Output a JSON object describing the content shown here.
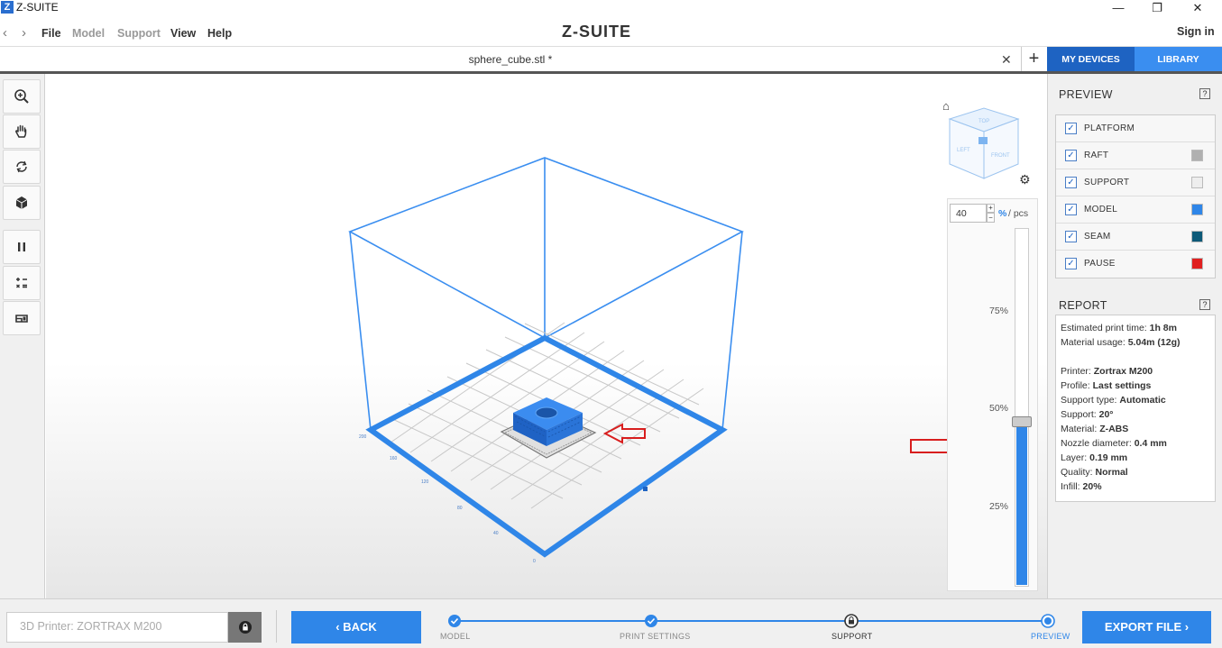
{
  "window": {
    "logo_letter": "Z",
    "title": "Z-SUITE",
    "minimize": "—",
    "maximize": "❐",
    "close": "✕"
  },
  "menubar": {
    "items": [
      "File",
      "Model",
      "Support",
      "View",
      "Help"
    ],
    "brand": "Z-SUITE",
    "signin": "Sign in"
  },
  "tabbar": {
    "file_tab": "sphere_cube.stl *",
    "close": "✕",
    "add": "+",
    "my_devices": "MY DEVICES",
    "library": "LIBRARY"
  },
  "toolbar": {
    "tools": [
      "zoom-icon",
      "pan-hand-icon",
      "rotate-icon",
      "view-cube-icon",
      "pause-icon",
      "calculator-icon",
      "layers-icon"
    ]
  },
  "viewport": {
    "cube_faces": [
      "TOP",
      "LEFT",
      "FRONT"
    ],
    "layer_value": "40",
    "unit_percent": "%",
    "unit_pcs": "/ pcs",
    "slider_ticks": [
      "75%",
      "50%",
      "25%"
    ],
    "slider_level": 0.46,
    "axis_labels": [
      "0",
      "40",
      "80",
      "120",
      "160",
      "200"
    ]
  },
  "preview": {
    "title": "PREVIEW",
    "help": "?",
    "items": [
      {
        "label": "PLATFORM",
        "checked": true,
        "color": ""
      },
      {
        "label": "RAFT",
        "checked": true,
        "color": "#b0b0b0"
      },
      {
        "label": "SUPPORT",
        "checked": true,
        "color": "#eeeeee"
      },
      {
        "label": "MODEL",
        "checked": true,
        "color": "#2f86e8"
      },
      {
        "label": "SEAM",
        "checked": true,
        "color": "#0d5a78"
      },
      {
        "label": "PAUSE",
        "checked": true,
        "color": "#e02020"
      }
    ]
  },
  "report": {
    "title": "REPORT",
    "help": "?",
    "lines": [
      {
        "label": "Estimated print time:",
        "value": "1h 8m"
      },
      {
        "label": "Material usage:",
        "value": "5.04m (12g)"
      },
      {
        "label": "Printer:",
        "value": "Zortrax M200"
      },
      {
        "label": "Profile:",
        "value": "Last settings"
      },
      {
        "label": "Support type:",
        "value": "Automatic"
      },
      {
        "label": "Support:",
        "value": "20°"
      },
      {
        "label": "Material:",
        "value": "Z-ABS"
      },
      {
        "label": "Nozzle diameter:",
        "value": "0.4 mm"
      },
      {
        "label": "Layer:",
        "value": "0.19 mm"
      },
      {
        "label": "Quality:",
        "value": "Normal"
      },
      {
        "label": "Infill:",
        "value": "20%"
      }
    ]
  },
  "bottombar": {
    "printer_placeholder": "3D Printer: ZORTRAX M200",
    "back": "BACK",
    "export": "EXPORT FILE",
    "steps": [
      {
        "label": "MODEL",
        "state": "done"
      },
      {
        "label": "PRINT SETTINGS",
        "state": "done"
      },
      {
        "label": "SUPPORT",
        "state": "locked"
      },
      {
        "label": "PREVIEW",
        "state": "current"
      }
    ]
  },
  "colors": {
    "accent": "#2f86e8",
    "dark_accent": "#1e63c2",
    "annotation_red": "#d81e1e"
  }
}
